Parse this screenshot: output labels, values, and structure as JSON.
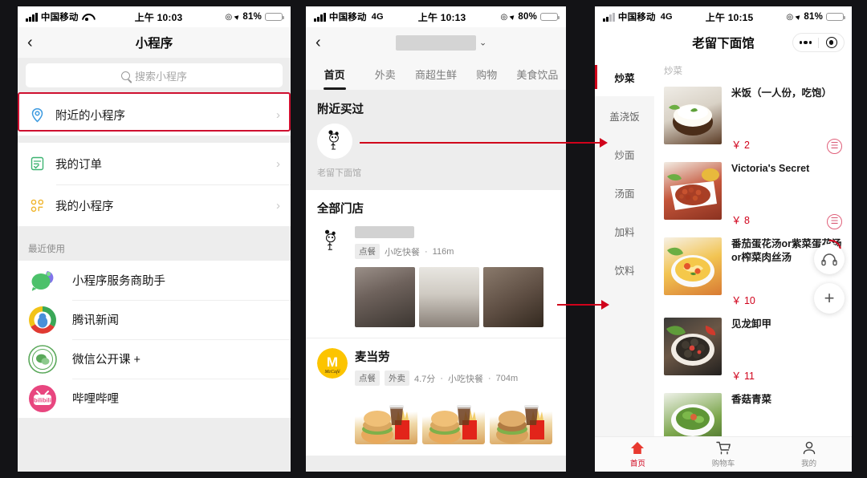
{
  "panels": {
    "left": {
      "statusbar": {
        "carrier": "中国移动",
        "network": "",
        "time": "上午 10:03",
        "battery": "81%"
      },
      "nav": {
        "title": "小程序",
        "back_icon": "chevron-left-icon"
      },
      "search": {
        "placeholder": "搜索小程序"
      },
      "menu": [
        {
          "label": "附近的小程序",
          "icon": "location-pin-icon",
          "highlighted": true
        },
        {
          "label": "我的订单",
          "icon": "order-list-icon",
          "highlighted": false
        },
        {
          "label": "我的小程序",
          "icon": "grid-apps-icon",
          "highlighted": false
        }
      ],
      "recent_header": "最近使用",
      "recent": [
        {
          "label": "小程序服务商助手",
          "icon": "leaf-chat-icon"
        },
        {
          "label": "腾讯新闻",
          "icon": "tencent-news-icon"
        },
        {
          "label": "微信公开课 +",
          "icon": "wechat-open-class-icon"
        },
        {
          "label": "哔哩哔哩",
          "icon": "bilibili-icon"
        }
      ]
    },
    "middle": {
      "statusbar": {
        "carrier": "中国移动",
        "network": "4G",
        "time": "上午 10:13",
        "battery": "80%"
      },
      "nav": {
        "title": "",
        "title_redacted": true,
        "chevron": "chevron-down-icon",
        "back_icon": "chevron-left-icon"
      },
      "tabs": [
        {
          "label": "首页",
          "active": true
        },
        {
          "label": "外卖",
          "active": false
        },
        {
          "label": "商超生鲜",
          "active": false
        },
        {
          "label": "购物",
          "active": false
        },
        {
          "label": "美食饮品",
          "active": false
        }
      ],
      "nearby_section_title": "附近买过",
      "nearby_item": {
        "name": "老留下面馆"
      },
      "all_stores_title": "全部门店",
      "stores": [
        {
          "name": "",
          "name_redacted": true,
          "tags": [
            "点餐"
          ],
          "rating": "",
          "category": "小吃快餐",
          "distance": "116m",
          "photos": [
            "store-photo-queue",
            "store-photo-corridor",
            "store-photo-hall"
          ]
        },
        {
          "name": "麦当劳",
          "name_redacted": false,
          "tags": [
            "点餐",
            "外卖"
          ],
          "rating": "4.7分",
          "category": "小吃快餐",
          "distance": "704m",
          "photos": [
            "combo-photo-1",
            "combo-photo-2",
            "combo-photo-3"
          ]
        }
      ]
    },
    "right": {
      "statusbar": {
        "carrier": "中国移动",
        "network": "4G",
        "time": "上午 10:15",
        "battery": "81%"
      },
      "nav": {
        "title": "老留下面馆",
        "capsule": [
          "more-dots-icon",
          "target-circle-icon"
        ]
      },
      "categories": [
        {
          "label": "炒菜",
          "active": true
        },
        {
          "label": "盖浇饭",
          "active": false
        },
        {
          "label": "炒面",
          "active": false
        },
        {
          "label": "汤面",
          "active": false
        },
        {
          "label": "加料",
          "active": false
        },
        {
          "label": "饮料",
          "active": false
        }
      ],
      "dish_group_header": "炒菜",
      "dishes": [
        {
          "name": "米饭（一人份，吃饱）",
          "price": "￥ 2",
          "image": "rice-bowl-photo"
        },
        {
          "name": "Victoria's Secret",
          "price": "￥ 8",
          "image": "fried-peanuts-photo"
        },
        {
          "name": "番茄蛋花汤or紫菜蛋花汤or榨菜肉丝汤",
          "price": "￥ 10",
          "image": "egg-drop-soup-photo"
        },
        {
          "name": "见龙卸甲",
          "price": "￥ 11",
          "image": "clams-photo"
        },
        {
          "name": "香菇青菜",
          "price": "",
          "image": "mushroom-greens-photo"
        }
      ],
      "fabs": [
        {
          "icon": "headset-icon",
          "label": "客服"
        },
        {
          "icon": "plus-icon",
          "label": "添加"
        }
      ],
      "tabbar": [
        {
          "label": "首页",
          "icon": "home-icon",
          "active": true
        },
        {
          "label": "购物车",
          "icon": "cart-icon",
          "active": false
        },
        {
          "label": "我的",
          "icon": "person-icon",
          "active": false
        }
      ]
    }
  },
  "annotations": {
    "highlight_color": "#cf1030",
    "arrows": [
      {
        "from": "nearby-bought-avatar",
        "to": "right-panel-category-chaomian"
      },
      {
        "from": "store-photos-row",
        "to": "right-panel-dish-list"
      }
    ]
  }
}
